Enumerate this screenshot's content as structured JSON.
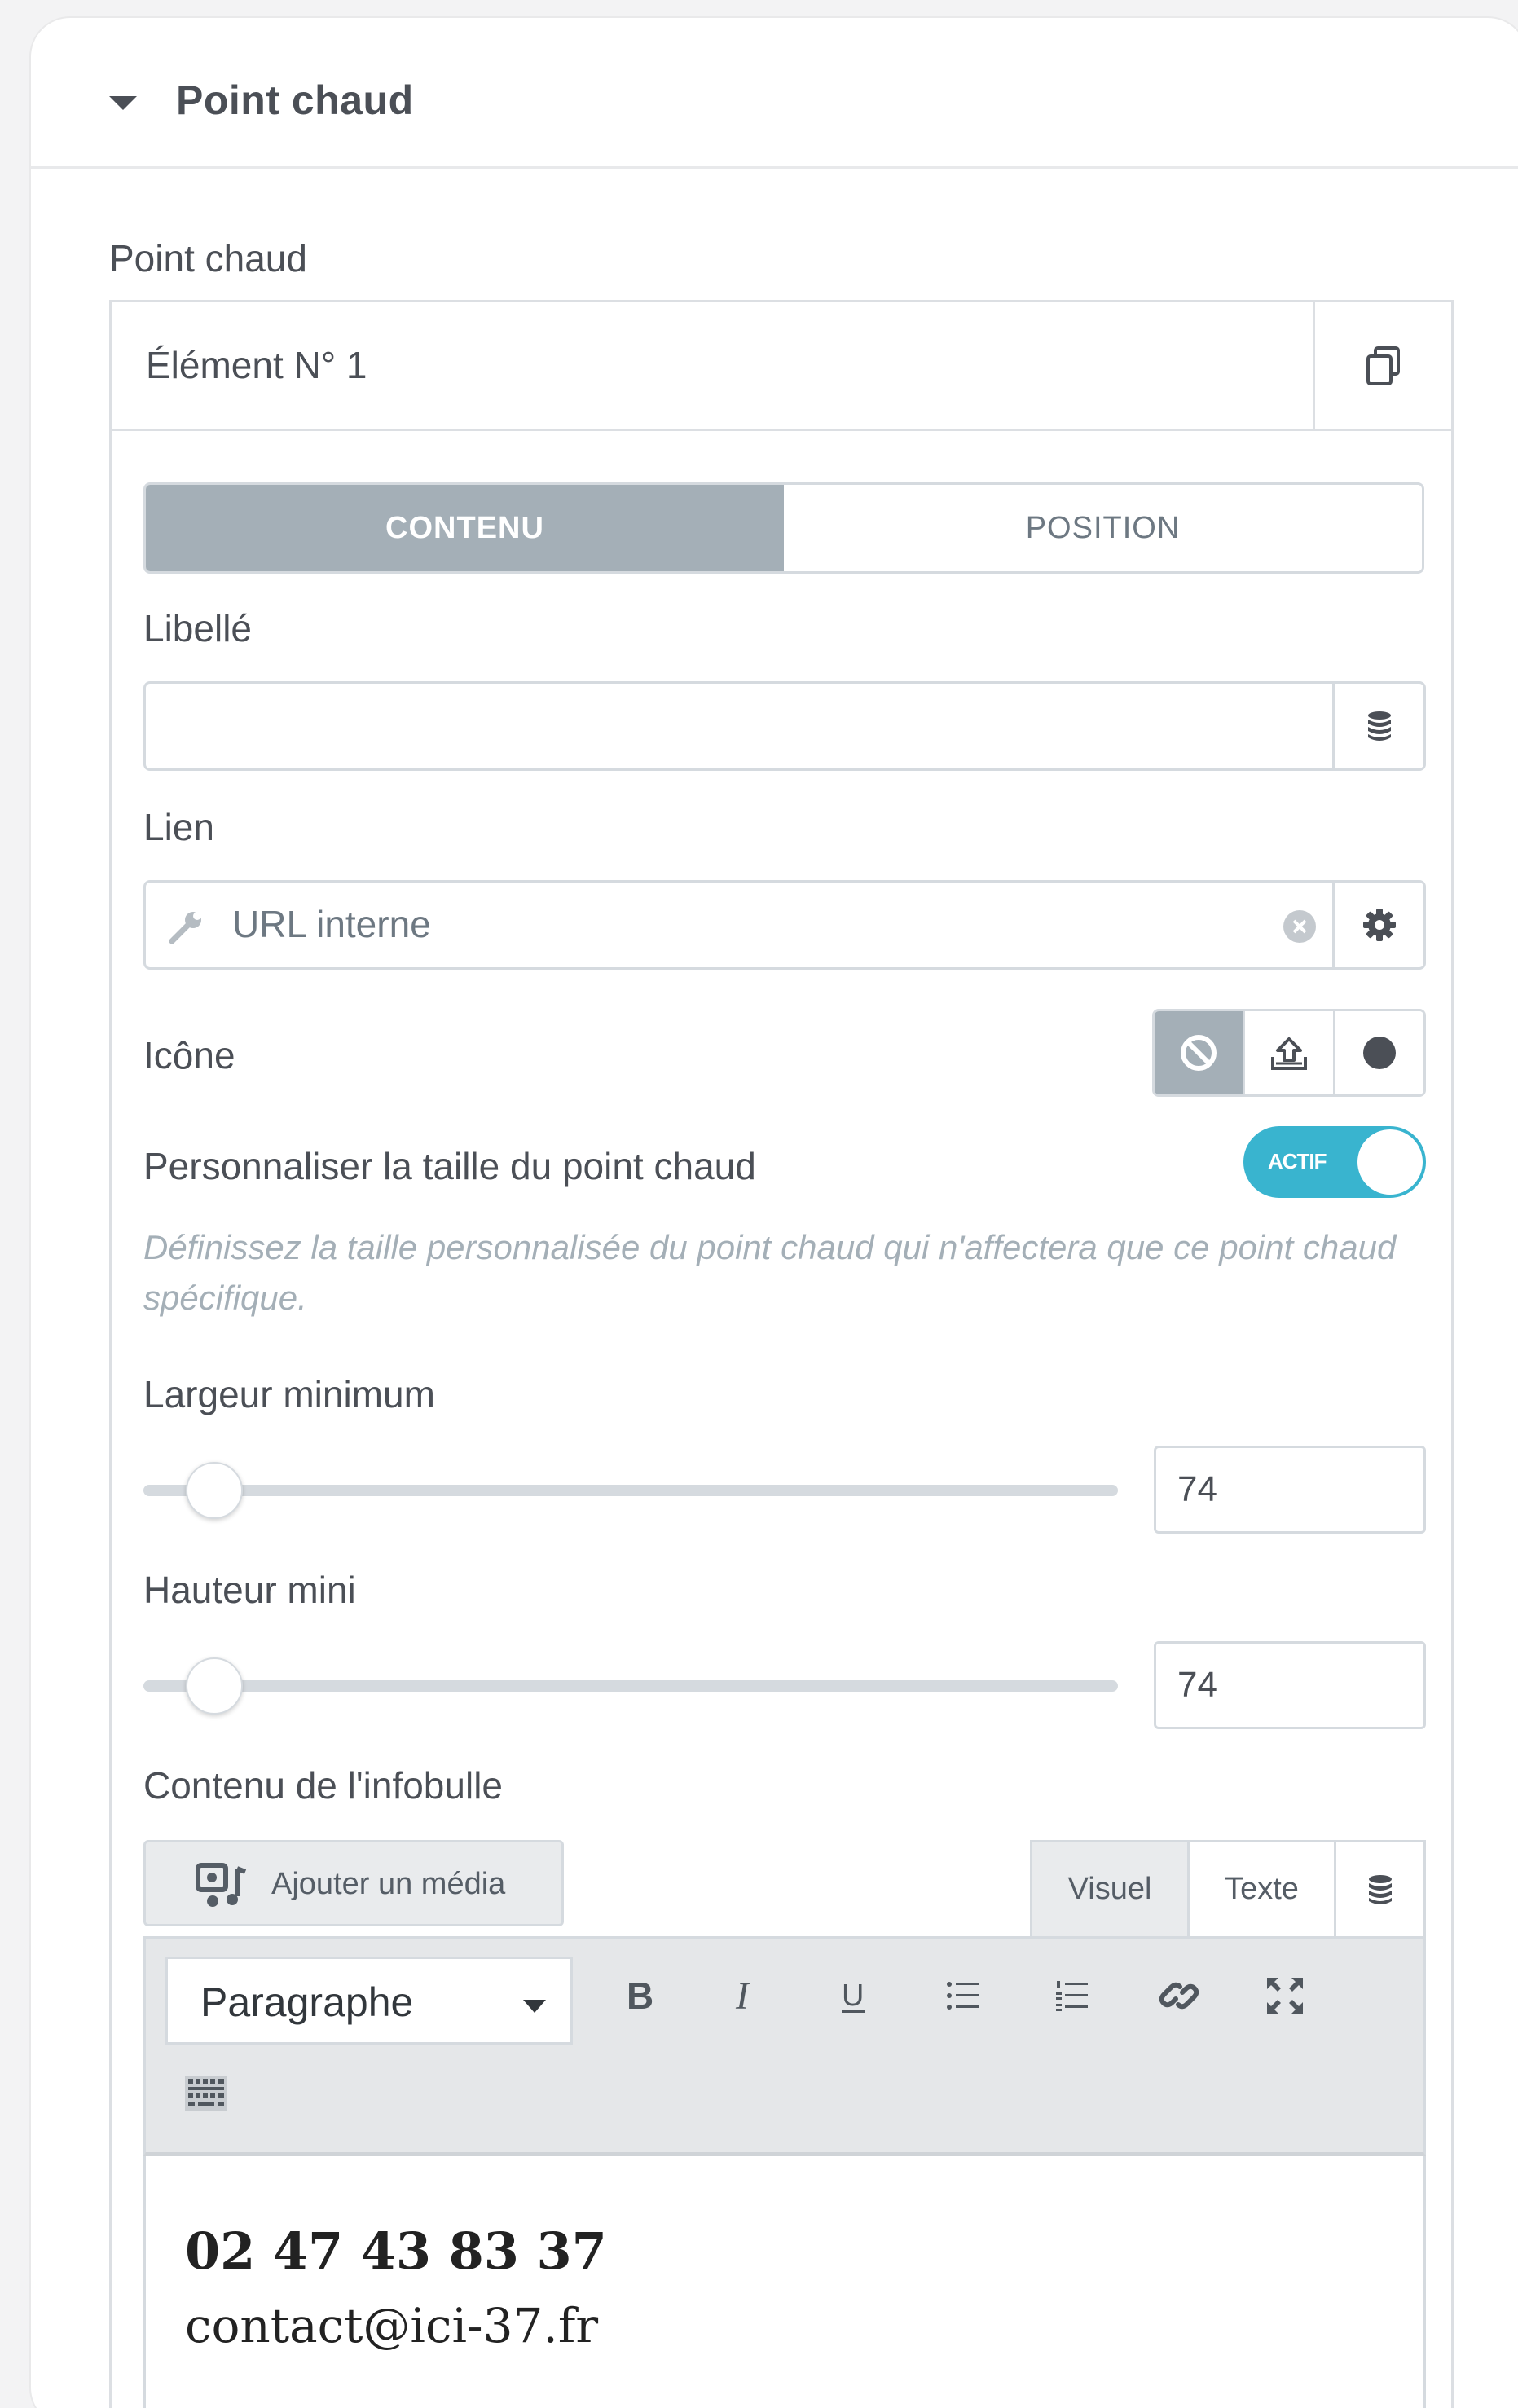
{
  "section": {
    "title": "Point chaud"
  },
  "repeater": {
    "label": "Point chaud",
    "item_title": "Élément N° 1"
  },
  "tabs": [
    {
      "label": "CONTENU",
      "active": true
    },
    {
      "label": "POSITION",
      "active": false
    }
  ],
  "fields": {
    "libelle_label": "Libellé",
    "libelle_value": "",
    "lien_label": "Lien",
    "lien_placeholder": "URL interne",
    "icone_label": "Icône",
    "icone_options": [
      "none-icon",
      "upload-icon",
      "circle-icon"
    ],
    "custom_size_label": "Personnaliser la taille du point chaud",
    "custom_size_toggle": "ACTIF",
    "custom_size_desc": "Définissez la taille personnalisée du point chaud qui n'affectera que ce point chaud spécifique.",
    "largeur_label": "Largeur minimum",
    "largeur_value": "74",
    "hauteur_label": "Hauteur mini",
    "hauteur_value": "74",
    "infobulle_label": "Contenu de l'infobulle"
  },
  "editor": {
    "add_media": "Ajouter un média",
    "mode_visual": "Visuel",
    "mode_text": "Texte",
    "format": "Paragraphe",
    "toolbar": [
      "bold-icon",
      "italic-icon",
      "underline-icon",
      "bullet-list-icon",
      "numbered-list-icon",
      "link-icon",
      "fullscreen-icon",
      "keyboard-icon"
    ],
    "content_line1": "02 47 43 83 37",
    "content_line2": "contact@ici-37.fr"
  },
  "colors": {
    "accent": "#39b4cf",
    "tab_active": "#a4afb7",
    "border": "#d5dadf",
    "text": "#4b4f56"
  }
}
